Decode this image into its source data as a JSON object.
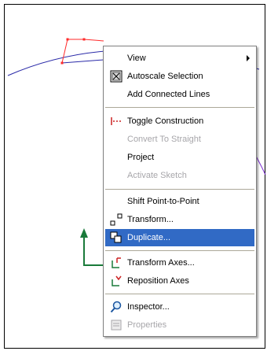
{
  "colors": {
    "sketch_curve": "#2a2aa8",
    "profile_line": "#ff2a2a",
    "axis_arrow": "#1a7a3a",
    "highlight": "#316ac5",
    "disabled_text": "#a7a6aa"
  },
  "context_menu": {
    "items": [
      {
        "label": "View",
        "icon": null,
        "submenu": true,
        "disabled": false,
        "highlighted": false
      },
      {
        "label": "Autoscale Selection",
        "icon": "autoscale-icon",
        "submenu": false,
        "disabled": false,
        "highlighted": false
      },
      {
        "label": "Add Connected Lines",
        "icon": null,
        "submenu": false,
        "disabled": false,
        "highlighted": false
      },
      {
        "label": "Toggle Construction",
        "icon": "toggle-construction-icon",
        "submenu": false,
        "disabled": false,
        "highlighted": false
      },
      {
        "label": "Convert To Straight",
        "icon": null,
        "submenu": false,
        "disabled": true,
        "highlighted": false
      },
      {
        "label": "Project",
        "icon": null,
        "submenu": false,
        "disabled": false,
        "highlighted": false
      },
      {
        "label": "Activate Sketch",
        "icon": null,
        "submenu": false,
        "disabled": true,
        "highlighted": false
      },
      {
        "label": "Shift Point-to-Point",
        "icon": null,
        "submenu": false,
        "disabled": false,
        "highlighted": false
      },
      {
        "label": "Transform...",
        "icon": "transform-icon",
        "submenu": false,
        "disabled": false,
        "highlighted": false
      },
      {
        "label": "Duplicate...",
        "icon": "duplicate-icon",
        "submenu": false,
        "disabled": false,
        "highlighted": true
      },
      {
        "label": "Transform Axes...",
        "icon": "transform-axes-icon",
        "submenu": false,
        "disabled": false,
        "highlighted": false
      },
      {
        "label": "Reposition Axes",
        "icon": "reposition-axes-icon",
        "submenu": false,
        "disabled": false,
        "highlighted": false
      },
      {
        "label": "Inspector...",
        "icon": "inspector-icon",
        "submenu": false,
        "disabled": false,
        "highlighted": false
      },
      {
        "label": "Properties",
        "icon": "properties-icon",
        "submenu": false,
        "disabled": true,
        "highlighted": false
      }
    ]
  }
}
